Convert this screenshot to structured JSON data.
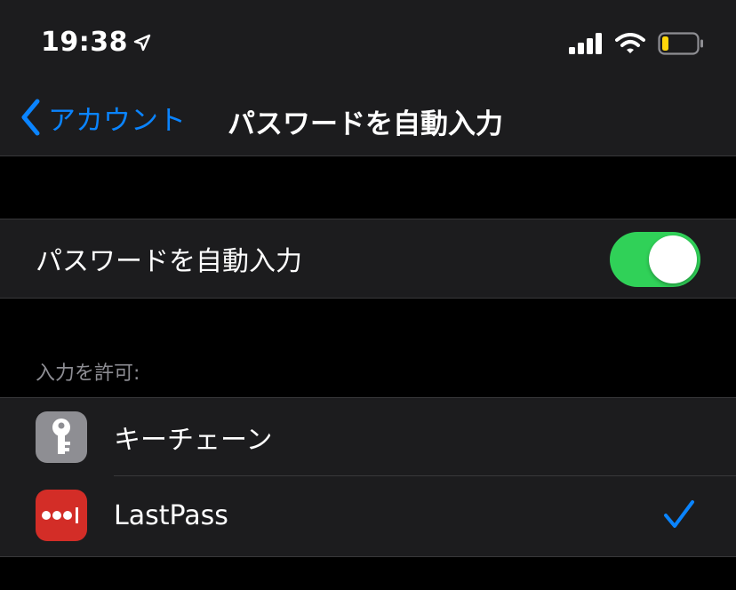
{
  "status_bar": {
    "time": "19:38",
    "location_icon": "location-arrow-icon",
    "signal_icon": "cellular-signal-icon",
    "wifi_icon": "wifi-icon",
    "battery_icon": "battery-low-icon",
    "battery_color": "#ffd60a"
  },
  "nav": {
    "back_label": "アカウント",
    "title": "パスワードを自動入力"
  },
  "autofill": {
    "label": "パスワードを自動入力",
    "enabled": true,
    "toggle_color": "#30d158"
  },
  "allow_section": {
    "header": "入力を許可:",
    "items": [
      {
        "label": "キーチェーン",
        "icon": "key-icon",
        "icon_bg": "#8e8e93",
        "checked": false
      },
      {
        "label": "LastPass",
        "icon": "lastpass-icon",
        "icon_bg": "#d32d27",
        "checked": true
      }
    ]
  },
  "colors": {
    "accent": "#0a84ff",
    "background": "#000000",
    "cell": "#1c1c1e"
  }
}
